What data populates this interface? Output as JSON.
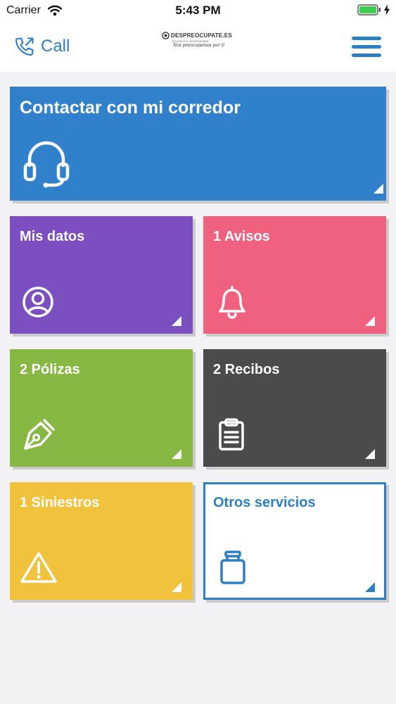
{
  "status_bar": {
    "carrier": "Carrier",
    "time": "5:43 PM"
  },
  "nav": {
    "call_label": "Call",
    "logo": {
      "brand": "DESPREOCUPATE.ES",
      "tagline": "SEGUROS E INVERSIONES",
      "slogan": "Nos preocupamos por ti"
    }
  },
  "tiles": {
    "contact": {
      "title": "Contactar con mi corredor",
      "icon": "headset-icon",
      "color": "#3080cb"
    },
    "mis_datos": {
      "title": "Mis datos",
      "icon": "user-circle-icon",
      "color": "#7b4fc0"
    },
    "avisos": {
      "title": "1 Avisos",
      "icon": "bell-icon",
      "color": "#f0607f"
    },
    "polizas": {
      "title": "2 Pólizas",
      "icon": "pen-nib-icon",
      "color": "#86b843"
    },
    "recibos": {
      "title": "2 Recibos",
      "icon": "clipboard-icon",
      "color": "#4b4b4d"
    },
    "siniestros": {
      "title": "1 Siniestros",
      "icon": "warning-icon",
      "color": "#f1c23b"
    },
    "otros": {
      "title": "Otros servicios",
      "icon": "jar-icon",
      "color": "#2d7fc3"
    }
  },
  "colors": {
    "accent": "#2d7fc3",
    "background": "#f2f2f4"
  }
}
